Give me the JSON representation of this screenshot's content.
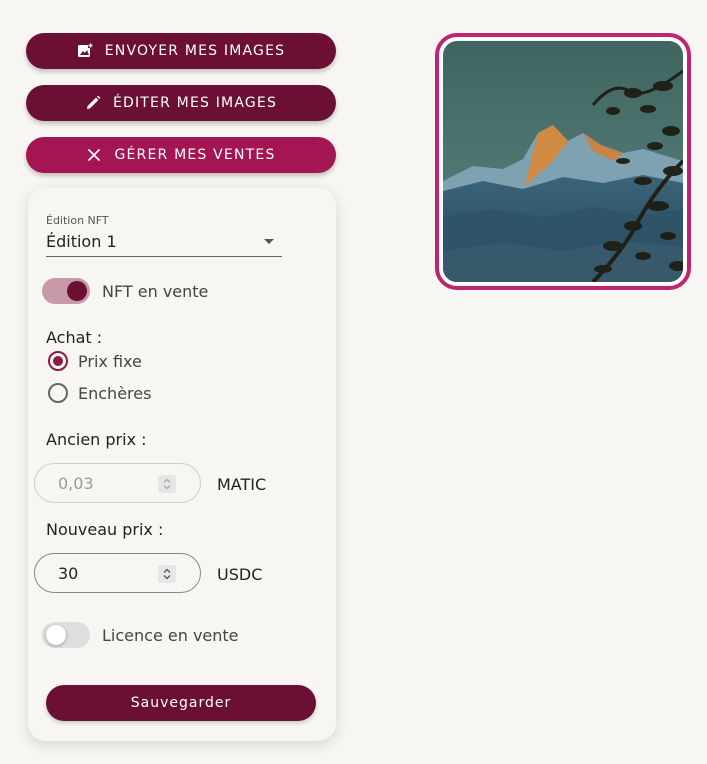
{
  "actions": {
    "upload_label": "ENVOYER MES IMAGES",
    "edit_label": "ÉDITER MES IMAGES",
    "manage_sales_label": "GÉRER MES VENTES"
  },
  "form": {
    "edition_select": {
      "label": "Édition NFT",
      "value": "Édition 1"
    },
    "nft_for_sale": {
      "label": "NFT en vente",
      "on": true
    },
    "purchase": {
      "label": "Achat :",
      "options": [
        {
          "label": "Prix fixe",
          "checked": true
        },
        {
          "label": "Enchères",
          "checked": false
        }
      ]
    },
    "old_price": {
      "label": "Ancien prix :",
      "value": "0,03",
      "unit": "MATIC",
      "disabled": true
    },
    "new_price": {
      "label": "Nouveau prix :",
      "value": "30",
      "unit": "USDC"
    },
    "license_for_sale": {
      "label": "Licence en vente",
      "on": false
    },
    "save_label": "Sauvegarder"
  },
  "colors": {
    "primary_dark": "#6b0f35",
    "primary_pink": "#a31553",
    "image_border": "#c0246f",
    "background": "#f8f6f2"
  },
  "icons": {
    "upload": "add-photo-icon",
    "edit": "pencil-icon",
    "manage_sales": "close-icon",
    "spinner": "spin-arrows-icon"
  }
}
